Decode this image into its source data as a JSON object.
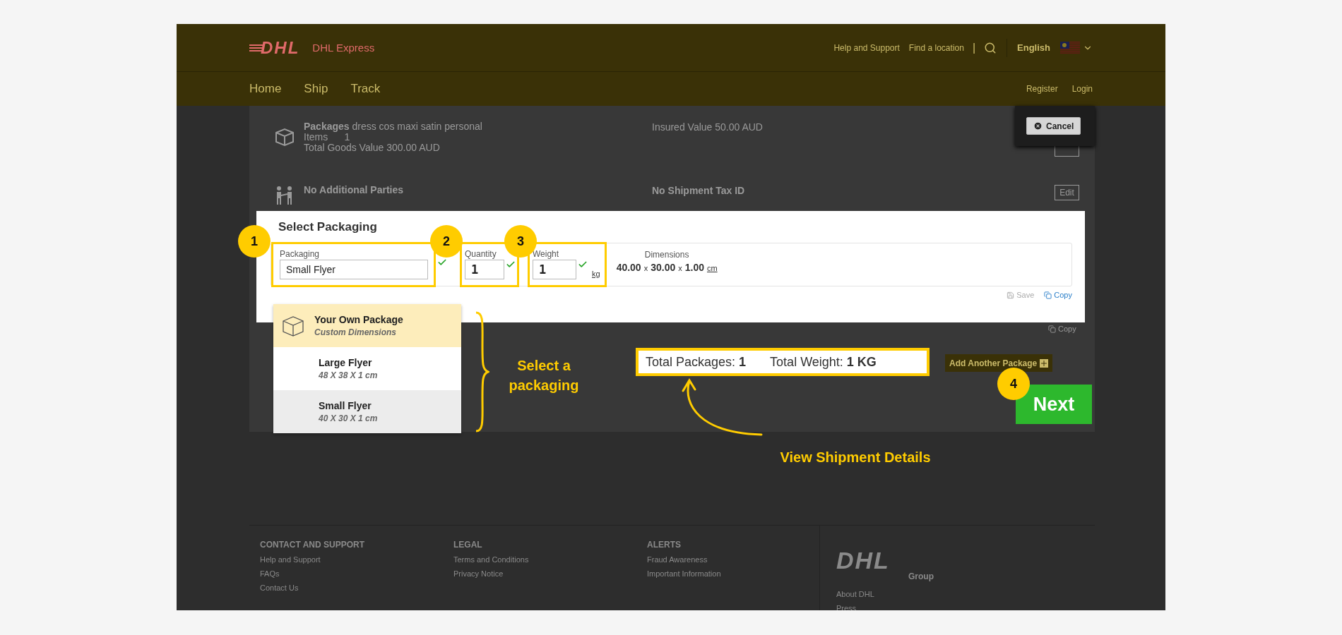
{
  "header": {
    "logo": "DHL",
    "brand": "DHL Express",
    "links": [
      "Help and Support",
      "Find a location"
    ],
    "separator": "|",
    "language": "English"
  },
  "nav": {
    "items": [
      "Home",
      "Ship",
      "Track"
    ],
    "account_links": [
      "Register",
      "Login"
    ]
  },
  "summary": {
    "rows": [
      {
        "kind": "packages",
        "title": "Packages",
        "description": "dress cos maxi satin personal",
        "items_label": "Items",
        "items_value": "1",
        "goods": "Total Goods Value 300.00 AUD",
        "right": "Insured Value 50.00 AUD"
      },
      {
        "kind": "parties",
        "title": "No Additional Parties",
        "right": "No Shipment Tax ID",
        "button": "Edit"
      }
    ],
    "copy": "Copy"
  },
  "cancel_button": "Cancel",
  "modal": {
    "title": "Select Packaging",
    "fields": [
      {
        "label": "Packaging",
        "value": "Small Flyer",
        "valid": true,
        "step": "1"
      },
      {
        "label": "Quantity",
        "value": "1",
        "valid": true,
        "step": "2"
      },
      {
        "label": "Weight",
        "value": "1",
        "valid": true,
        "unit": "kg",
        "step": "3"
      }
    ],
    "dimensions": {
      "label": "Dimensions",
      "parts": [
        {
          "kind": "value",
          "text": "40.00"
        },
        {
          "kind": "sep",
          "text": "x"
        },
        {
          "kind": "value",
          "text": "30.00"
        },
        {
          "kind": "sep",
          "text": "x"
        },
        {
          "kind": "value",
          "text": "1.00"
        },
        {
          "kind": "unit",
          "text": "cm"
        }
      ]
    },
    "actions": [
      {
        "kind": "save",
        "label": "Save",
        "disabled": true
      },
      {
        "kind": "copy",
        "label": "Copy",
        "disabled": false
      }
    ]
  },
  "packaging_options": [
    {
      "name": "Your Own Package",
      "detail": "Custom Dimensions",
      "selected": true,
      "hovered": false,
      "kind": "custom"
    },
    {
      "name": "Large Flyer",
      "detail": "48 X 38 X 1 cm",
      "selected": false,
      "hovered": false,
      "kind": "flyer"
    },
    {
      "name": "Small Flyer",
      "detail": "40 X 30 X 1 cm",
      "selected": false,
      "hovered": true,
      "kind": "flyer"
    }
  ],
  "totals": {
    "packages_label": "Total Packages:",
    "packages": "1",
    "weight_label": "Total Weight:",
    "weight": "1 KG"
  },
  "add_package": "Add Another Package",
  "next": {
    "label": "Next",
    "step": "4"
  },
  "annotations": {
    "select_note": "Select a packaging",
    "details_note": "View Shipment Details"
  },
  "footer": {
    "columns": [
      {
        "heading": "CONTACT AND SUPPORT",
        "links": [
          "Help and Support",
          "FAQs",
          "Contact Us"
        ]
      },
      {
        "heading": "LEGAL",
        "links": [
          "Terms and Conditions",
          "Privacy Notice"
        ]
      },
      {
        "heading": "ALERTS",
        "links": [
          "Fraud Awareness",
          "Important Information"
        ]
      }
    ],
    "group_logo": "DHL",
    "group_label": "Group",
    "group_links": [
      "About DHL",
      "Press"
    ]
  }
}
